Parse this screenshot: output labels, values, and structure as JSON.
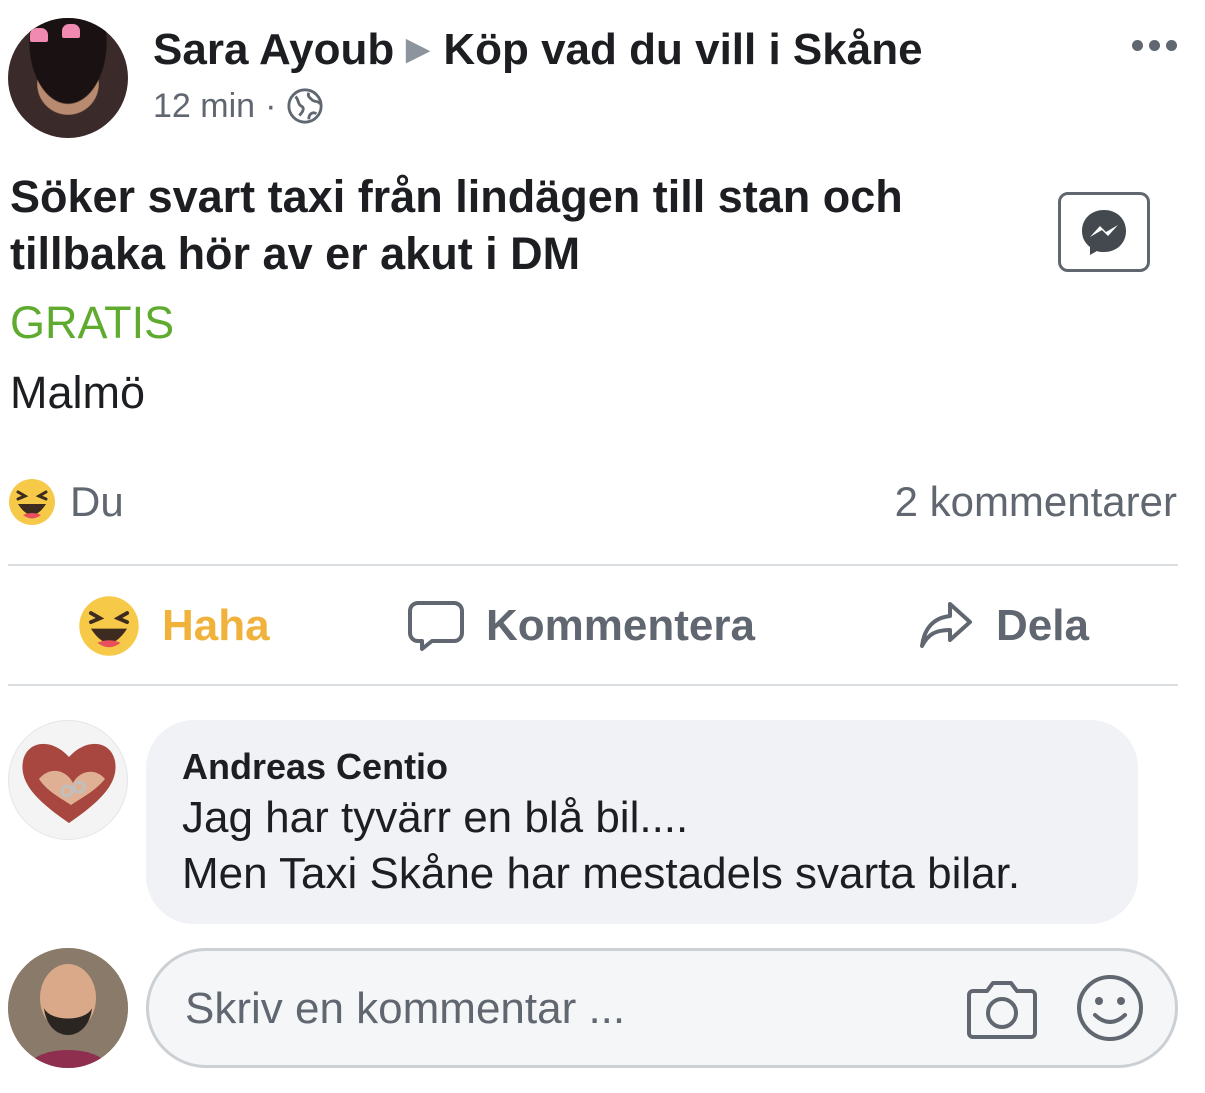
{
  "post": {
    "author": "Sara Ayoub",
    "group": "Köp vad du vill i Skåne",
    "time": "12 min",
    "time_separator": "·",
    "text_line1": "Söker svart taxi från lindägen till stan och",
    "text_line2": "tillbaka hör av er akut i DM",
    "price": "GRATIS",
    "location": "Malmö"
  },
  "reactions": {
    "reactor": "Du",
    "comment_count": "2 kommentarer"
  },
  "actions": {
    "haha": "Haha",
    "comment": "Kommentera",
    "share": "Dela"
  },
  "comment": {
    "author": "Andreas Centio",
    "line1": "Jag har tyvärr en blå bil....",
    "line2": "Men Taxi Skåne har mestadels svarta bilar."
  },
  "composer": {
    "placeholder": "Skriv en kommentar ..."
  },
  "colors": {
    "price_green": "#5fab2f",
    "haha_yellow": "#f0b23a",
    "secondary_text": "#606770"
  },
  "icons": [
    "globe-icon",
    "more-icon",
    "messenger-icon",
    "haha-emoji-icon",
    "comment-icon",
    "share-icon",
    "camera-icon",
    "smiley-icon"
  ]
}
